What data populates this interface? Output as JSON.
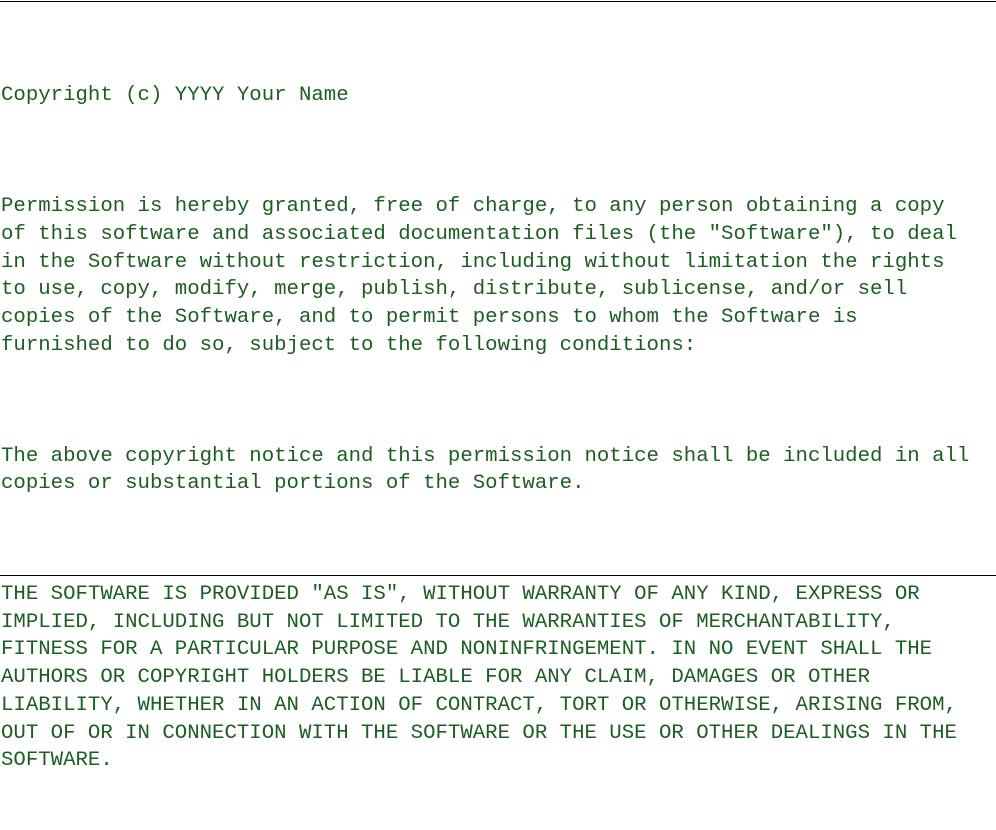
{
  "document": {
    "copyright": "Copyright (c) YYYY Your Name",
    "permission": "Permission is hereby granted, free of charge, to any person obtaining a copy\nof this software and associated documentation files (the \"Software\"), to deal\nin the Software without restriction, including without limitation the rights\nto use, copy, modify, merge, publish, distribute, sublicense, and/or sell\ncopies of the Software, and to permit persons to whom the Software is\nfurnished to do so, subject to the following conditions:",
    "notice": "The above copyright notice and this permission notice shall be included in all\ncopies or substantial portions of the Software.",
    "warranty": "THE SOFTWARE IS PROVIDED \"AS IS\", WITHOUT WARRANTY OF ANY KIND, EXPRESS OR\nIMPLIED, INCLUDING BUT NOT LIMITED TO THE WARRANTIES OF MERCHANTABILITY,\nFITNESS FOR A PARTICULAR PURPOSE AND NONINFRINGEMENT. IN NO EVENT SHALL THE\nAUTHORS OR COPYRIGHT HOLDERS BE LIABLE FOR ANY CLAIM, DAMAGES OR OTHER\nLIABILITY, WHETHER IN AN ACTION OF CONTRACT, TORT OR OTHERWISE, ARISING FROM,\nOUT OF OR IN CONNECTION WITH THE SOFTWARE OR THE USE OR OTHER DEALINGS IN THE\nSOFTWARE."
  },
  "colors": {
    "text": "#1b5e20",
    "rule": "#000000",
    "background": "#ffffff"
  }
}
